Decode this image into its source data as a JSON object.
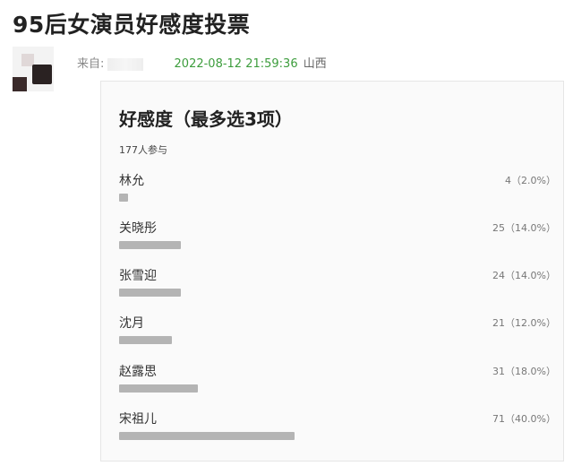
{
  "page": {
    "title": "95后女演员好感度投票"
  },
  "post": {
    "from_label": "来自:",
    "timestamp": "2022-08-12 21:59:36",
    "location": "山西"
  },
  "poll": {
    "title": "好感度（最多选3项）",
    "participants": "177人参与",
    "options": [
      {
        "name": "林允",
        "stat": "4（2.0%）",
        "share": 0.02
      },
      {
        "name": "关晓彤",
        "stat": "25（14.0%）",
        "share": 0.14
      },
      {
        "name": "张雪迎",
        "stat": "24（14.0%）",
        "share": 0.14
      },
      {
        "name": "沈月",
        "stat": "21（12.0%）",
        "share": 0.12
      },
      {
        "name": "赵露思",
        "stat": "31（18.0%）",
        "share": 0.18
      },
      {
        "name": "宋祖儿",
        "stat": "71（40.0%）",
        "share": 0.4
      }
    ]
  }
}
